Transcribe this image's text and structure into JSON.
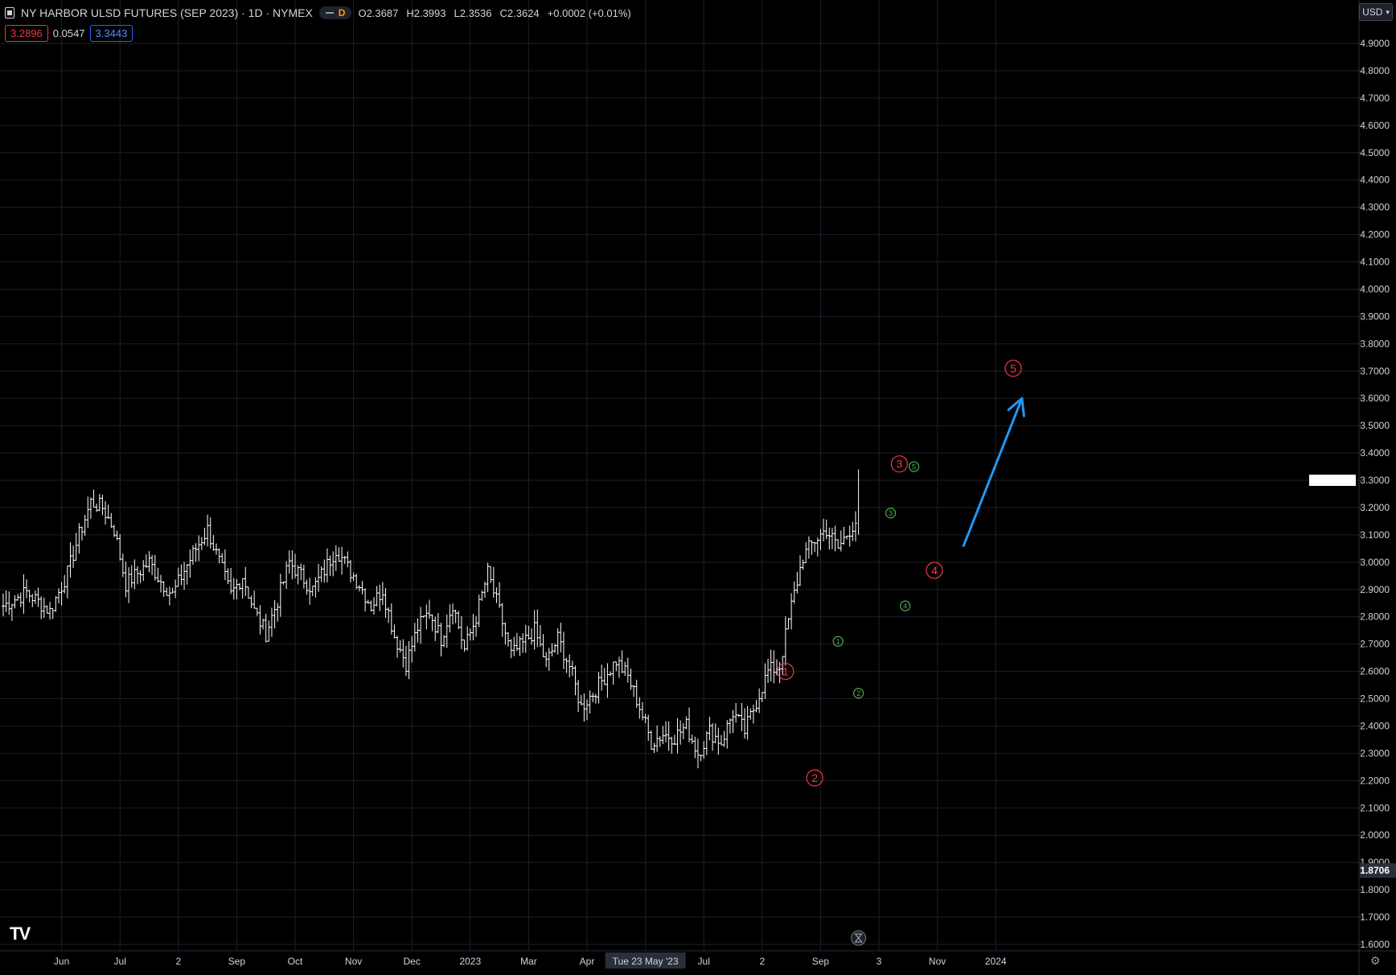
{
  "header": {
    "symbol_title": "NY HARBOR ULSD FUTURES (SEP 2023) · 1D · NYMEX",
    "interval_badge": "D",
    "ohlc": {
      "o": "O2.3687",
      "h": "H2.3993",
      "l": "L2.3536",
      "c": "C2.3624",
      "chg": "+0.0002 (+0.01%)"
    },
    "bid": "3.2896",
    "spread": "0.0547",
    "ask": "3.3443",
    "currency": "USD"
  },
  "logo_text": "TV",
  "colors": {
    "background": "#000000",
    "grid": "#1c1f2b",
    "bars": "#ffffff",
    "axis_text": "#d1d4dc",
    "wave_major": "#f23645",
    "wave_minor": "#4caf50",
    "arrow": "#2196f3",
    "axis_badge": "#2a2e39"
  },
  "chart_data": {
    "type": "ohlc",
    "ylim": [
      1.6,
      4.9
    ],
    "y_ticks": [
      "4.9000",
      "4.8000",
      "4.7000",
      "4.6000",
      "4.5000",
      "4.4000",
      "4.3000",
      "4.2000",
      "4.1000",
      "4.0000",
      "3.9000",
      "3.8000",
      "3.7000",
      "3.6000",
      "3.5000",
      "3.4000",
      "3.3000",
      "3.2000",
      "3.1000",
      "3.0000",
      "2.9000",
      "2.8000",
      "2.7000",
      "2.6000",
      "2.5000",
      "2.4000",
      "2.3000",
      "2.2000",
      "2.1000",
      "2.0000",
      "1.9000",
      "1.8000",
      "1.7000",
      "1.6000"
    ],
    "x_ticks": [
      "Jun",
      "Jul",
      "2",
      "Sep",
      "Oct",
      "Nov",
      "Dec",
      "2023",
      "Mar",
      "Apr",
      "Tue 23 May '23",
      "Jul",
      "2",
      "Sep",
      "3",
      "Nov",
      "2024"
    ],
    "x_ticks_idx": [
      20,
      40,
      60,
      80,
      100,
      120,
      140,
      160,
      180,
      200,
      220,
      240,
      260,
      280,
      300,
      320,
      340
    ],
    "crosshair_x_label": "Tue 23 May '23",
    "crosshair_price_label": "1.8706",
    "last_price_marker": 3.3,
    "closes_by_index": [
      [
        0,
        2.84
      ],
      [
        8,
        2.89
      ],
      [
        16,
        2.82
      ],
      [
        22,
        2.96
      ],
      [
        26,
        3.1
      ],
      [
        30,
        3.22
      ],
      [
        34,
        3.2
      ],
      [
        38,
        3.12
      ],
      [
        42,
        2.92
      ],
      [
        46,
        2.96
      ],
      [
        50,
        3.0
      ],
      [
        54,
        2.93
      ],
      [
        58,
        2.88
      ],
      [
        62,
        2.97
      ],
      [
        66,
        3.05
      ],
      [
        70,
        3.12
      ],
      [
        74,
        3.0
      ],
      [
        78,
        2.88
      ],
      [
        82,
        2.95
      ],
      [
        86,
        2.82
      ],
      [
        90,
        2.74
      ],
      [
        94,
        2.86
      ],
      [
        98,
        3.0
      ],
      [
        102,
        2.95
      ],
      [
        106,
        2.9
      ],
      [
        110,
        2.97
      ],
      [
        114,
        3.05
      ],
      [
        118,
        2.98
      ],
      [
        122,
        2.92
      ],
      [
        126,
        2.84
      ],
      [
        130,
        2.9
      ],
      [
        134,
        2.73
      ],
      [
        138,
        2.63
      ],
      [
        142,
        2.76
      ],
      [
        146,
        2.82
      ],
      [
        150,
        2.72
      ],
      [
        154,
        2.85
      ],
      [
        158,
        2.68
      ],
      [
        162,
        2.8
      ],
      [
        166,
        2.96
      ],
      [
        170,
        2.82
      ],
      [
        174,
        2.66
      ],
      [
        178,
        2.7
      ],
      [
        182,
        2.75
      ],
      [
        186,
        2.63
      ],
      [
        190,
        2.72
      ],
      [
        194,
        2.62
      ],
      [
        198,
        2.47
      ],
      [
        202,
        2.52
      ],
      [
        206,
        2.58
      ],
      [
        210,
        2.64
      ],
      [
        214,
        2.58
      ],
      [
        218,
        2.47
      ],
      [
        222,
        2.34
      ],
      [
        226,
        2.37
      ],
      [
        230,
        2.36
      ],
      [
        234,
        2.4
      ],
      [
        238,
        2.3
      ],
      [
        242,
        2.38
      ],
      [
        246,
        2.34
      ],
      [
        250,
        2.45
      ],
      [
        254,
        2.38
      ],
      [
        258,
        2.49
      ],
      [
        262,
        2.6
      ],
      [
        266,
        2.62
      ],
      [
        270,
        2.84
      ],
      [
        274,
        3.02
      ],
      [
        278,
        3.08
      ],
      [
        282,
        3.12
      ],
      [
        286,
        3.05
      ],
      [
        290,
        3.12
      ],
      [
        292,
        3.15
      ]
    ],
    "wave_labels_major": [
      {
        "label": "1",
        "x": 268,
        "y": 2.6
      },
      {
        "label": "2",
        "x": 278,
        "y": 2.21
      },
      {
        "label": "3",
        "x": 307,
        "y": 3.36
      },
      {
        "label": "4",
        "x": 319,
        "y": 2.97
      },
      {
        "label": "5",
        "x": 346,
        "y": 3.71
      }
    ],
    "wave_labels_minor": [
      {
        "label": "1",
        "x": 286,
        "y": 2.71
      },
      {
        "label": "2",
        "x": 293,
        "y": 2.52
      },
      {
        "label": "3",
        "x": 304,
        "y": 3.18
      },
      {
        "label": "4",
        "x": 309,
        "y": 2.84
      },
      {
        "label": "5",
        "x": 312,
        "y": 3.35
      }
    ],
    "projection_arrow": {
      "from": [
        329,
        3.06
      ],
      "to": [
        349,
        3.6
      ]
    }
  }
}
